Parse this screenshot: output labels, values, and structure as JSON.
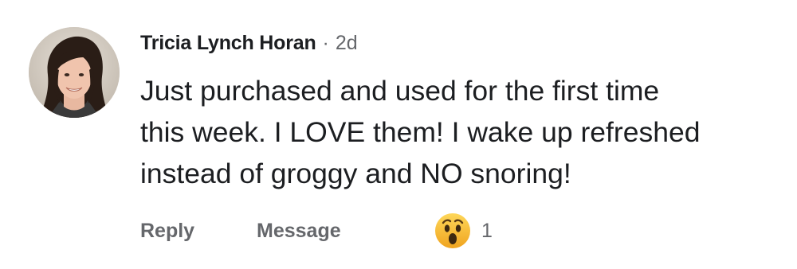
{
  "comment": {
    "author": "Tricia Lynch Horan",
    "separator": "·",
    "time": "2d",
    "body_lines": [
      "Just purchased and used for the first time",
      "this week. I LOVE them!  I wake up refreshed",
      "instead of groggy and NO snoring!"
    ],
    "actions": {
      "reply": "Reply",
      "message": "Message"
    },
    "reaction": {
      "icon": "wow-emoji-icon",
      "count": "1"
    }
  },
  "colors": {
    "text_primary": "#1c1e21",
    "text_secondary": "#65676b",
    "reaction_yellow": "#f7b125"
  }
}
